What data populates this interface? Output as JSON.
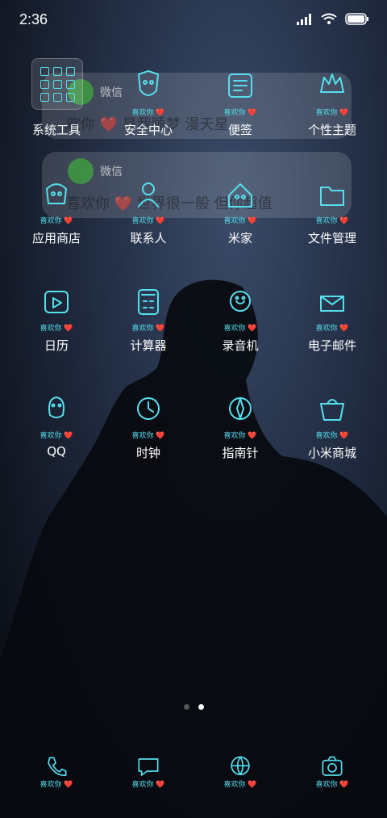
{
  "status_bar": {
    "time": "2:36"
  },
  "notifications": [
    {
      "app": "微信",
      "message": "欢你 ❤️ 是我睡梦 漫天星"
    },
    {
      "app": "微信",
      "message": "喜欢你 ❤️ 世界很一般 但你超值"
    }
  ],
  "tag_text": "喜欢你 ❤️",
  "apps": [
    {
      "label": "系统工具",
      "icon": "folder-icon"
    },
    {
      "label": "安全中心",
      "icon": "shield-icon"
    },
    {
      "label": "便签",
      "icon": "notes-icon"
    },
    {
      "label": "个性主题",
      "icon": "theme-icon"
    },
    {
      "label": "应用商店",
      "icon": "store-icon"
    },
    {
      "label": "联系人",
      "icon": "contacts-icon"
    },
    {
      "label": "米家",
      "icon": "mijia-icon"
    },
    {
      "label": "文件管理",
      "icon": "files-icon"
    },
    {
      "label": "日历",
      "icon": "calendar-icon"
    },
    {
      "label": "计算器",
      "icon": "calculator-icon"
    },
    {
      "label": "录音机",
      "icon": "recorder-icon"
    },
    {
      "label": "电子邮件",
      "icon": "mail-icon"
    },
    {
      "label": "QQ",
      "icon": "qq-icon"
    },
    {
      "label": "时钟",
      "icon": "clock-icon"
    },
    {
      "label": "指南针",
      "icon": "compass-icon"
    },
    {
      "label": "小米商城",
      "icon": "mi-store-icon"
    }
  ],
  "dock": [
    {
      "icon": "phone-icon"
    },
    {
      "icon": "messages-icon"
    },
    {
      "icon": "browser-icon"
    },
    {
      "icon": "camera-icon"
    }
  ],
  "page_indicator": {
    "count": 2,
    "active": 2
  },
  "colors": {
    "accent": "#55e0ee"
  }
}
